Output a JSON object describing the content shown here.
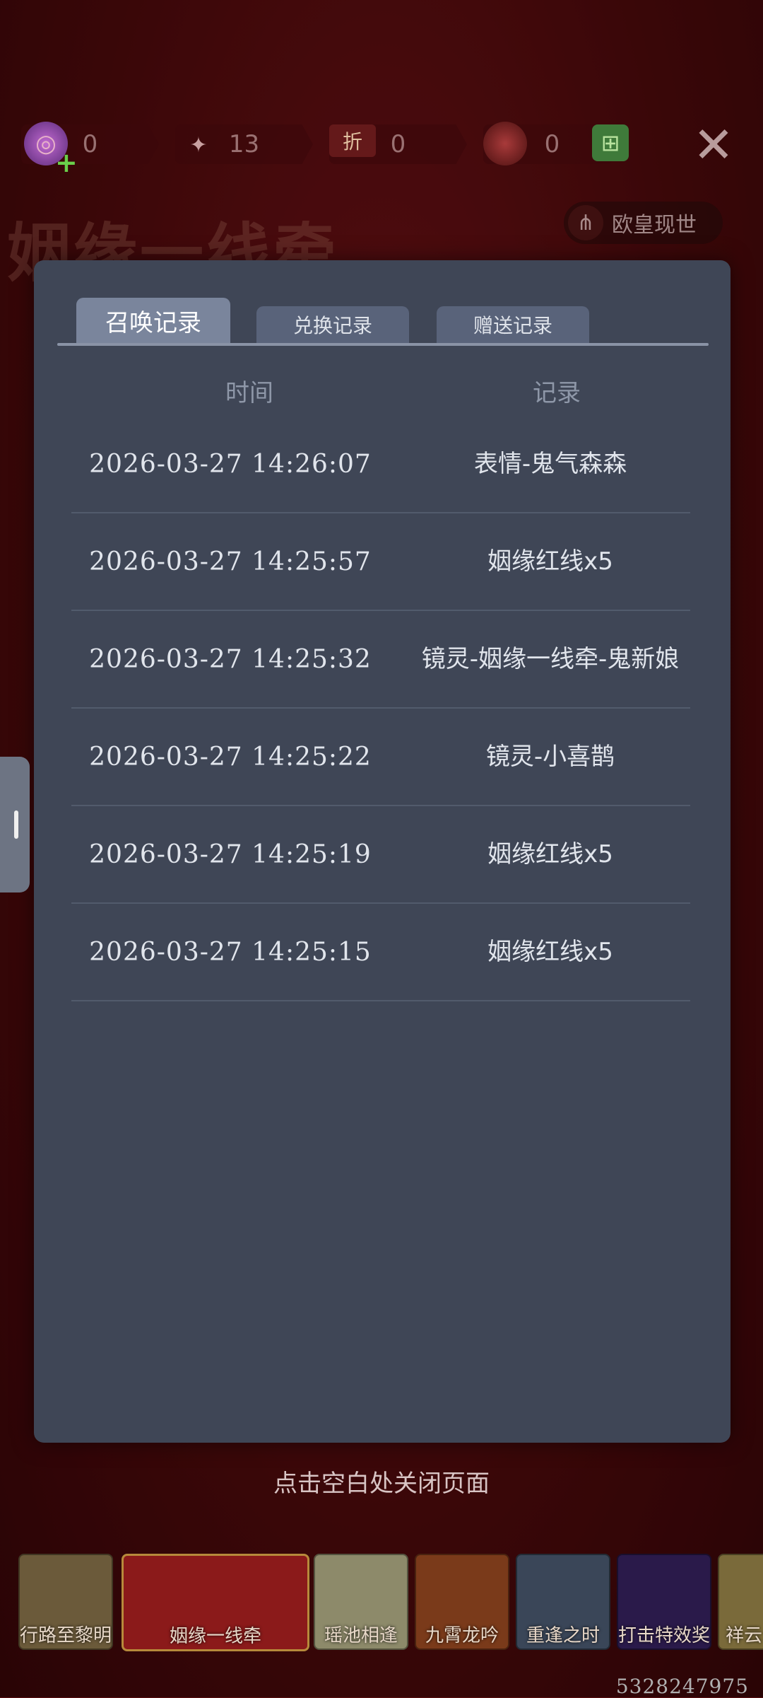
{
  "background": {
    "title": "姻缘一线牵"
  },
  "currencies": [
    {
      "icon": "candy-icon",
      "value": "0"
    },
    {
      "icon": "token-icon",
      "value": "13"
    },
    {
      "icon": "discount-ticket-icon",
      "icon_text": "折",
      "value": "0"
    },
    {
      "icon": "orb-icon",
      "value": "0"
    }
  ],
  "share_button": {
    "label": "欧皇现世"
  },
  "dialog": {
    "tabs": [
      {
        "label": "召唤记录",
        "active": true
      },
      {
        "label": "兑换记录",
        "active": false
      },
      {
        "label": "赠送记录",
        "active": false
      }
    ],
    "headers": {
      "time": "时间",
      "record": "记录"
    },
    "rows": [
      {
        "time": "2026-03-27 14:26:07",
        "record": "表情-鬼气森森"
      },
      {
        "time": "2026-03-27 14:25:57",
        "record": "姻缘红线x5"
      },
      {
        "time": "2026-03-27 14:25:32",
        "record": "镜灵-姻缘一线牵-鬼新娘"
      },
      {
        "time": "2026-03-27 14:25:22",
        "record": "镜灵-小喜鹊"
      },
      {
        "time": "2026-03-27 14:25:19",
        "record": "姻缘红线x5"
      },
      {
        "time": "2026-03-27 14:25:15",
        "record": "姻缘红线x5"
      }
    ]
  },
  "close_hint": "点击空白处关闭页面",
  "carousel": [
    {
      "label": "行路至黎明",
      "selected": false
    },
    {
      "label": "姻缘一线牵",
      "selected": true
    },
    {
      "label": "瑶池相逢",
      "selected": false
    },
    {
      "label": "九霄龙吟",
      "selected": false
    },
    {
      "label": "重逢之时",
      "selected": false
    },
    {
      "label": "打击特效奖池",
      "selected": false
    },
    {
      "label": "祥云",
      "selected": false
    }
  ],
  "footer_id": "5328247975",
  "colors": {
    "dialog_bg": "#3f4656",
    "active_tab": "#7a859c",
    "selected_card_border": "#b78a3b"
  }
}
